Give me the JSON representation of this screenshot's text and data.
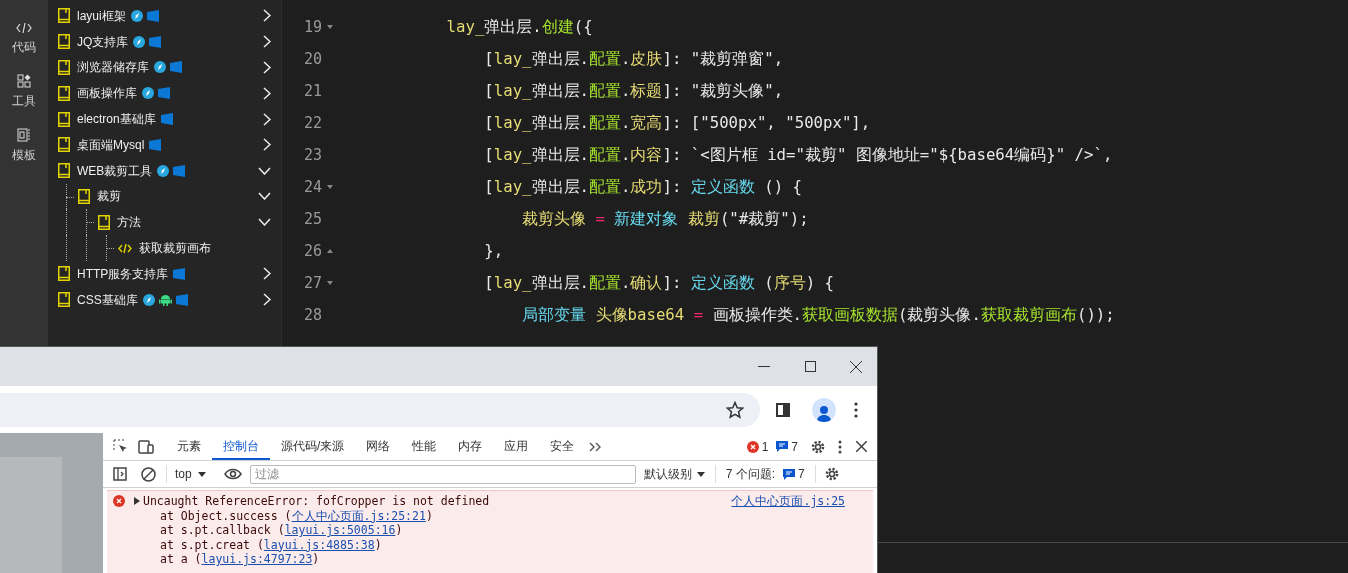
{
  "rail": [
    {
      "label": "代码"
    },
    {
      "label": "工具"
    },
    {
      "label": "模板"
    }
  ],
  "tree": [
    {
      "kind": "folder",
      "label": "layui框架",
      "badges": [
        {
          "kind": "web"
        },
        {
          "kind": "windows"
        }
      ],
      "expanded": false
    },
    {
      "kind": "folder",
      "label": "JQ支持库",
      "badges": [
        {
          "kind": "web"
        },
        {
          "kind": "windows"
        }
      ],
      "expanded": false
    },
    {
      "kind": "folder",
      "label": "浏览器储存库",
      "badges": [
        {
          "kind": "web"
        },
        {
          "kind": "windows"
        }
      ],
      "expanded": false
    },
    {
      "kind": "folder",
      "label": "画板操作库",
      "badges": [
        {
          "kind": "web"
        },
        {
          "kind": "windows"
        }
      ],
      "expanded": false
    },
    {
      "kind": "folder",
      "label": "electron基础库",
      "badges": [
        {
          "kind": "windows"
        }
      ],
      "expanded": false
    },
    {
      "kind": "folder",
      "label": "桌面端Mysql",
      "badges": [
        {
          "kind": "windows"
        }
      ],
      "expanded": false
    },
    {
      "kind": "folder",
      "label": "WEB裁剪工具",
      "badges": [
        {
          "kind": "web"
        },
        {
          "kind": "windows"
        }
      ],
      "expanded": true,
      "children": [
        {
          "kind": "folder",
          "label": "裁剪",
          "expanded": true,
          "children": [
            {
              "kind": "folder",
              "label": "方法",
              "expanded": true,
              "children": [
                {
                  "kind": "method",
                  "label": "获取裁剪画布"
                }
              ]
            }
          ]
        }
      ]
    },
    {
      "kind": "folder",
      "label": "HTTP服务支持库",
      "badges": [
        {
          "kind": "windows"
        }
      ],
      "expanded": false
    },
    {
      "kind": "folder",
      "label": "CSS基础库",
      "badges": [
        {
          "kind": "web"
        },
        {
          "kind": "android"
        },
        {
          "kind": "windows"
        }
      ],
      "expanded": false
    }
  ],
  "editor": {
    "lines": [
      {
        "number": "19",
        "fold_start": true,
        "tokens": [
          {
            "text": "        lay_",
            "kind": "var"
          },
          {
            "text": "弹出层.",
            "kind": "plain"
          },
          {
            "text": "创建",
            "kind": "member"
          },
          {
            "text": "({",
            "kind": "plain"
          }
        ]
      },
      {
        "number": "20",
        "tokens": [
          {
            "text": "            [",
            "kind": "plain"
          },
          {
            "text": "lay_",
            "kind": "var"
          },
          {
            "text": "弹出层.",
            "kind": "plain"
          },
          {
            "text": "配置",
            "kind": "member"
          },
          {
            "text": ".",
            "kind": "plain"
          },
          {
            "text": "皮肤",
            "kind": "var"
          },
          {
            "text": "]: \"裁剪弹窗\",",
            "kind": "plain"
          }
        ]
      },
      {
        "number": "21",
        "tokens": [
          {
            "text": "            [",
            "kind": "plain"
          },
          {
            "text": "lay_",
            "kind": "var"
          },
          {
            "text": "弹出层.",
            "kind": "plain"
          },
          {
            "text": "配置",
            "kind": "member"
          },
          {
            "text": ".",
            "kind": "plain"
          },
          {
            "text": "标题",
            "kind": "var"
          },
          {
            "text": "]: \"裁剪头像\",",
            "kind": "plain"
          }
        ]
      },
      {
        "number": "22",
        "tokens": [
          {
            "text": "            [",
            "kind": "plain"
          },
          {
            "text": "lay_",
            "kind": "var"
          },
          {
            "text": "弹出层.",
            "kind": "plain"
          },
          {
            "text": "配置",
            "kind": "member"
          },
          {
            "text": ".",
            "kind": "plain"
          },
          {
            "text": "宽高",
            "kind": "var"
          },
          {
            "text": "]: [\"500px\", \"500px\"],",
            "kind": "plain"
          }
        ]
      },
      {
        "number": "23",
        "tokens": [
          {
            "text": "            [",
            "kind": "plain"
          },
          {
            "text": "lay_",
            "kind": "var"
          },
          {
            "text": "弹出层.",
            "kind": "plain"
          },
          {
            "text": "配置",
            "kind": "member"
          },
          {
            "text": ".",
            "kind": "plain"
          },
          {
            "text": "内容",
            "kind": "var"
          },
          {
            "text": "]: `<图片框 id=\"裁剪\" 图像地址=\"${base64编码}\" />`,",
            "kind": "plain"
          }
        ]
      },
      {
        "number": "24",
        "fold_start": true,
        "tokens": [
          {
            "text": "            [",
            "kind": "plain"
          },
          {
            "text": "lay_",
            "kind": "var"
          },
          {
            "text": "弹出层.",
            "kind": "plain"
          },
          {
            "text": "配置",
            "kind": "member"
          },
          {
            "text": ".",
            "kind": "plain"
          },
          {
            "text": "成功",
            "kind": "var"
          },
          {
            "text": "]: ",
            "kind": "plain"
          },
          {
            "text": "定义函数",
            "kind": "keyword"
          },
          {
            "text": " () {",
            "kind": "plain"
          }
        ]
      },
      {
        "number": "25",
        "tokens": [
          {
            "text": "                裁剪头像",
            "kind": "var"
          },
          {
            "text": " = ",
            "kind": "operator"
          },
          {
            "text": "新建对象",
            "kind": "keyword"
          },
          {
            "text": " 裁剪",
            "kind": "var"
          },
          {
            "text": "(\"#裁剪\");",
            "kind": "plain"
          }
        ]
      },
      {
        "number": "26",
        "fold_end": true,
        "tokens": [
          {
            "text": "            },",
            "kind": "plain"
          }
        ]
      },
      {
        "number": "27",
        "fold_start": true,
        "tokens": [
          {
            "text": "            [",
            "kind": "plain"
          },
          {
            "text": "lay_",
            "kind": "var"
          },
          {
            "text": "弹出层.",
            "kind": "plain"
          },
          {
            "text": "配置",
            "kind": "member"
          },
          {
            "text": ".",
            "kind": "plain"
          },
          {
            "text": "确认",
            "kind": "var"
          },
          {
            "text": "]: ",
            "kind": "plain"
          },
          {
            "text": "定义函数",
            "kind": "keyword"
          },
          {
            "text": " (",
            "kind": "plain"
          },
          {
            "text": "序号",
            "kind": "var"
          },
          {
            "text": ") {",
            "kind": "plain"
          }
        ]
      },
      {
        "number": "28",
        "tokens": [
          {
            "text": "                局部变量",
            "kind": "keyword"
          },
          {
            "text": " 头像base64",
            "kind": "var"
          },
          {
            "text": " = ",
            "kind": "operator"
          },
          {
            "text": "画板操作类.",
            "kind": "plain"
          },
          {
            "text": "获取画板数据",
            "kind": "member"
          },
          {
            "text": "(裁剪头像.",
            "kind": "plain"
          },
          {
            "text": "获取裁剪画布",
            "kind": "member"
          },
          {
            "text": "());",
            "kind": "plain"
          }
        ]
      }
    ]
  },
  "devtools": {
    "tabs": [
      {
        "label": "元素",
        "selected": false
      },
      {
        "label": "控制台",
        "selected": true
      },
      {
        "label": "源代码/来源",
        "selected": false
      },
      {
        "label": "网络",
        "selected": false
      },
      {
        "label": "性能",
        "selected": false
      },
      {
        "label": "内存",
        "selected": false
      },
      {
        "label": "应用",
        "selected": false
      },
      {
        "label": "安全",
        "selected": false
      }
    ],
    "error_count": "1",
    "message_count": "7",
    "context": "top",
    "filter": {
      "placeholder": "过滤"
    },
    "level_select": "默认级别",
    "issues_label": "7 个问题:",
    "issues_count": "7",
    "error": {
      "message": "Uncaught ReferenceError: fofCropper is not defined",
      "source": "个人中心页面.js:25",
      "stack": [
        {
          "before": "at Object.success (",
          "link": "个人中心页面.js:25:21",
          "after": ")"
        },
        {
          "before": "at s.pt.callback (",
          "link": "layui.js:5005:16",
          "after": ")"
        },
        {
          "before": "at s.pt.creat (",
          "link": "layui.js:4885:38",
          "after": ")"
        },
        {
          "before": "at a (",
          "link": "layui.js:4797:23",
          "after": ")"
        }
      ]
    }
  }
}
